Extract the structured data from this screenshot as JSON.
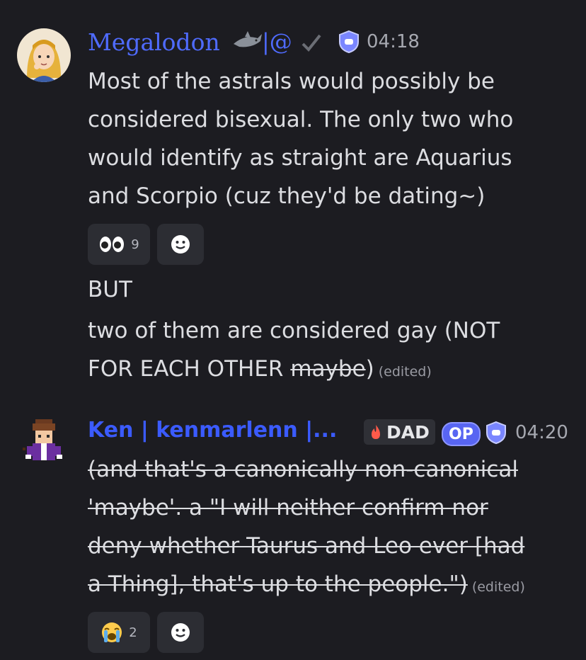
{
  "messages": [
    {
      "author": "Megalodon",
      "author_suffix": "|@",
      "time": "04:18",
      "lines": [
        "Most of the astrals would possibly be",
        "considered bisexual. The only two who",
        "would identify as straight are Aquarius",
        "and Scorpio (cuz they'd be dating~)"
      ],
      "reactions": [
        {
          "emoji": "👀",
          "count": "9"
        },
        {
          "emoji": "add-reaction"
        }
      ],
      "followups": [
        {
          "text": "BUT"
        },
        {
          "text": "two of them are considered gay (NOT"
        },
        {
          "text_pre": "FOR EACH OTHER ",
          "text_strike": "maybe",
          "text_post": ")",
          "edited": "(edited)"
        }
      ]
    },
    {
      "author": "Ken | kenmarlenn |...",
      "role_tag": "DAD",
      "op_tag": "OP",
      "time": "04:20",
      "lines": [
        "(and that's a canonically non-canonical",
        "'maybe'. a \"I will neither confirm nor",
        "deny whether Taurus and Leo ever [had",
        "a Thing], that's up to the people.\")"
      ],
      "edited": "(edited)",
      "reactions": [
        {
          "emoji": "😭",
          "count": "2"
        },
        {
          "emoji": "add-reaction"
        }
      ]
    }
  ],
  "colors": {
    "background": "#1c1c21",
    "author1": "#4f6bff",
    "author2": "#3b5bff",
    "op_badge": "#5865f2",
    "shield": "#7a86ff"
  }
}
